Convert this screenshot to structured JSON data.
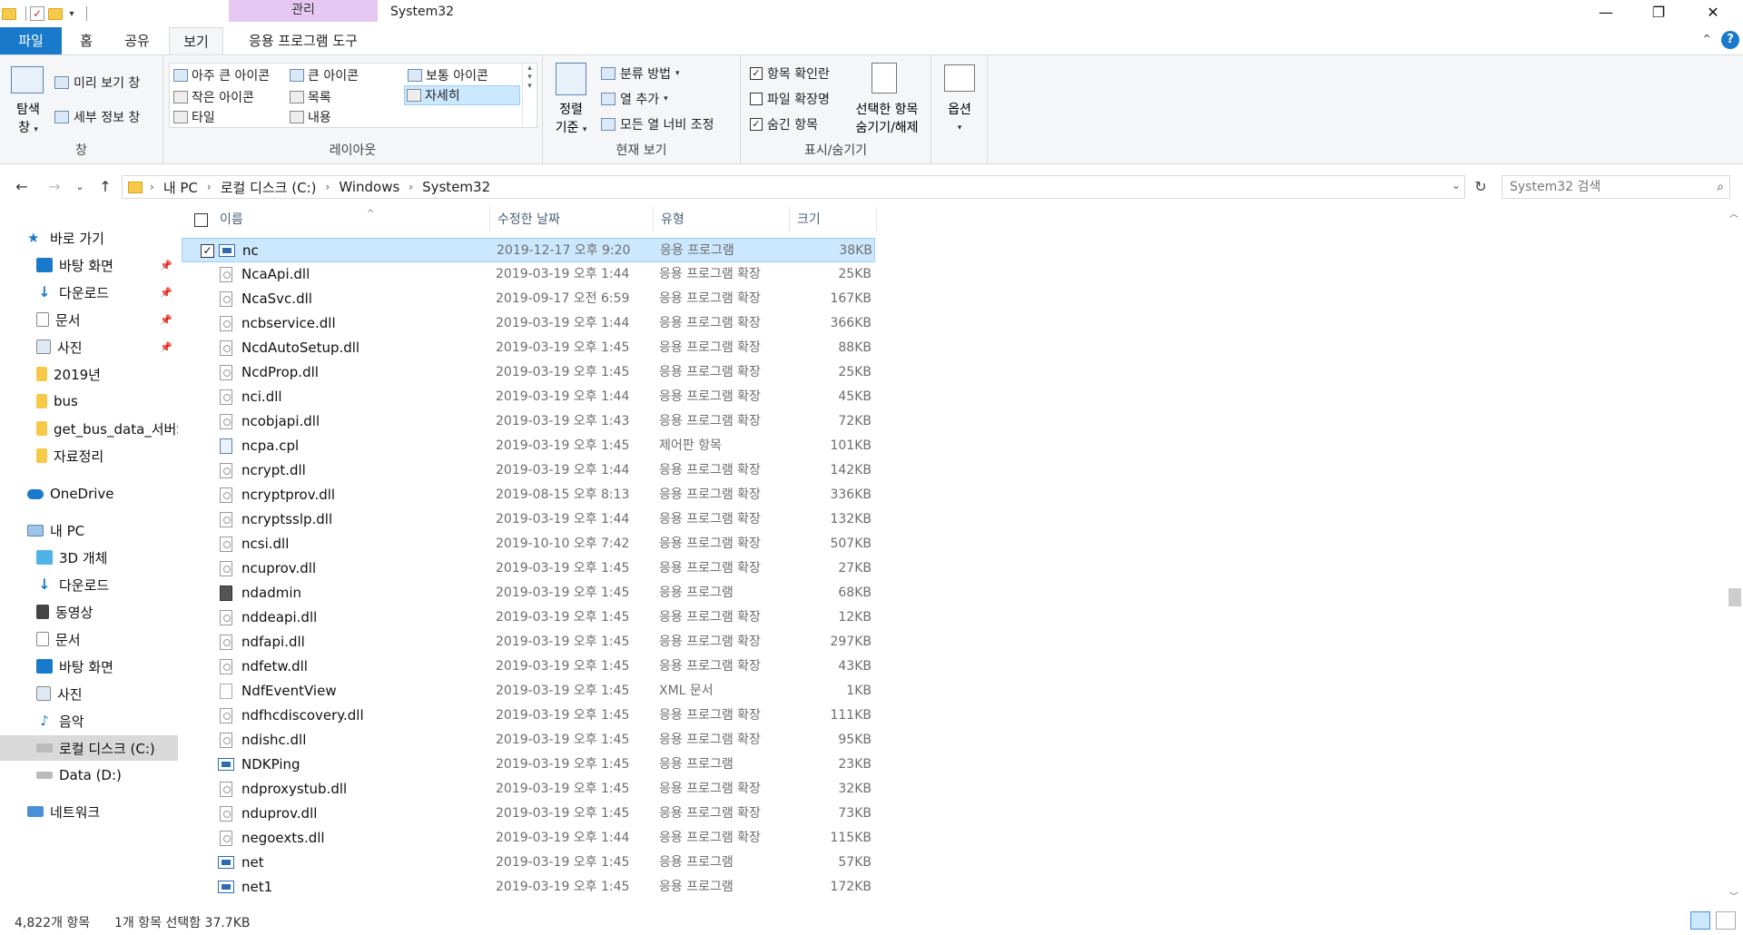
{
  "titlebar": {
    "manage_tab": "관리",
    "title": "System32",
    "minimize": "—",
    "maximize": "❐",
    "close": "✕"
  },
  "tabs": {
    "file": "파일",
    "home": "홈",
    "share": "공유",
    "view": "보기",
    "app_tools": "응용 프로그램 도구"
  },
  "ribbon": {
    "pane_group": {
      "nav_pane": "탐색",
      "nav_pane_2": "창",
      "preview": "미리 보기 창",
      "details": "세부 정보 창",
      "label": "창"
    },
    "layout_group": {
      "extra_large": "아주 큰 아이콘",
      "large": "큰 아이콘",
      "medium": "보통 아이콘",
      "small": "작은 아이콘",
      "list": "목록",
      "details": "자세히",
      "tiles": "타일",
      "content": "내용",
      "label": "레이아웃"
    },
    "current_view_group": {
      "sort_by": "정렬",
      "sort_by_2": "기준",
      "group_by": "분류 방법",
      "add_columns": "열 추가",
      "size_all_columns": "모든 열 너비 조정",
      "label": "현재 보기"
    },
    "show_hide_group": {
      "item_checkboxes": "항목 확인란",
      "file_extensions": "파일 확장명",
      "hidden_items": "숨긴 항목",
      "hide_selected": "선택한 항목",
      "hide_selected_2": "숨기기/해제",
      "label": "표시/숨기기"
    },
    "options": "옵션"
  },
  "address": {
    "crumbs": [
      "내 PC",
      "로컬 디스크 (C:)",
      "Windows",
      "System32"
    ],
    "search_placeholder": "System32 검색"
  },
  "navpane": {
    "quick_access": "바로 가기",
    "qa_items": [
      "바탕 화면",
      "다운로드",
      "문서",
      "사진",
      "2019년",
      "bus",
      "get_bus_data_서버S",
      "자료정리"
    ],
    "onedrive": "OneDrive",
    "this_pc": "내 PC",
    "pc_items": [
      "3D 개체",
      "다운로드",
      "동영상",
      "문서",
      "바탕 화면",
      "사진",
      "음악",
      "로컬 디스크 (C:)",
      "Data (D:)"
    ],
    "network": "네트워크"
  },
  "columns": {
    "name": "이름",
    "modified": "수정한 날짜",
    "type": "유형",
    "size": "크기"
  },
  "files": [
    {
      "name": "nc",
      "date": "2019-12-17 오후 9:20",
      "type": "응용 프로그램",
      "size": "38KB",
      "icon": "exe-icon",
      "selected": true
    },
    {
      "name": "NcaApi.dll",
      "date": "2019-03-19 오후 1:44",
      "type": "응용 프로그램 확장",
      "size": "25KB",
      "icon": "dll-icon"
    },
    {
      "name": "NcaSvc.dll",
      "date": "2019-09-17 오전 6:59",
      "type": "응용 프로그램 확장",
      "size": "167KB",
      "icon": "dll-icon"
    },
    {
      "name": "ncbservice.dll",
      "date": "2019-03-19 오후 1:44",
      "type": "응용 프로그램 확장",
      "size": "366KB",
      "icon": "dll-icon"
    },
    {
      "name": "NcdAutoSetup.dll",
      "date": "2019-03-19 오후 1:45",
      "type": "응용 프로그램 확장",
      "size": "88KB",
      "icon": "dll-icon"
    },
    {
      "name": "NcdProp.dll",
      "date": "2019-03-19 오후 1:45",
      "type": "응용 프로그램 확장",
      "size": "25KB",
      "icon": "dll-icon"
    },
    {
      "name": "nci.dll",
      "date": "2019-03-19 오후 1:44",
      "type": "응용 프로그램 확장",
      "size": "45KB",
      "icon": "dll-icon"
    },
    {
      "name": "ncobjapi.dll",
      "date": "2019-03-19 오후 1:43",
      "type": "응용 프로그램 확장",
      "size": "72KB",
      "icon": "dll-icon"
    },
    {
      "name": "ncpa.cpl",
      "date": "2019-03-19 오후 1:45",
      "type": "제어판 항목",
      "size": "101KB",
      "icon": "cpl-icon"
    },
    {
      "name": "ncrypt.dll",
      "date": "2019-03-19 오후 1:44",
      "type": "응용 프로그램 확장",
      "size": "142KB",
      "icon": "dll-icon"
    },
    {
      "name": "ncryptprov.dll",
      "date": "2019-08-15 오후 8:13",
      "type": "응용 프로그램 확장",
      "size": "336KB",
      "icon": "dll-icon"
    },
    {
      "name": "ncryptsslp.dll",
      "date": "2019-03-19 오후 1:44",
      "type": "응용 프로그램 확장",
      "size": "132KB",
      "icon": "dll-icon"
    },
    {
      "name": "ncsi.dll",
      "date": "2019-10-10 오후 7:42",
      "type": "응용 프로그램 확장",
      "size": "507KB",
      "icon": "dll-icon"
    },
    {
      "name": "ncuprov.dll",
      "date": "2019-03-19 오후 1:45",
      "type": "응용 프로그램 확장",
      "size": "27KB",
      "icon": "dll-icon"
    },
    {
      "name": "ndadmin",
      "date": "2019-03-19 오후 1:45",
      "type": "응용 프로그램",
      "size": "68KB",
      "icon": "admin-icon"
    },
    {
      "name": "nddeapi.dll",
      "date": "2019-03-19 오후 1:45",
      "type": "응용 프로그램 확장",
      "size": "12KB",
      "icon": "dll-icon"
    },
    {
      "name": "ndfapi.dll",
      "date": "2019-03-19 오후 1:45",
      "type": "응용 프로그램 확장",
      "size": "297KB",
      "icon": "dll-icon"
    },
    {
      "name": "ndfetw.dll",
      "date": "2019-03-19 오후 1:45",
      "type": "응용 프로그램 확장",
      "size": "43KB",
      "icon": "dll-icon"
    },
    {
      "name": "NdfEventView",
      "date": "2019-03-19 오후 1:45",
      "type": "XML 문서",
      "size": "1KB",
      "icon": "xml-icon"
    },
    {
      "name": "ndfhcdiscovery.dll",
      "date": "2019-03-19 오후 1:45",
      "type": "응용 프로그램 확장",
      "size": "111KB",
      "icon": "dll-icon"
    },
    {
      "name": "ndishc.dll",
      "date": "2019-03-19 오후 1:45",
      "type": "응용 프로그램 확장",
      "size": "95KB",
      "icon": "dll-icon"
    },
    {
      "name": "NDKPing",
      "date": "2019-03-19 오후 1:45",
      "type": "응용 프로그램",
      "size": "23KB",
      "icon": "exe-icon"
    },
    {
      "name": "ndproxystub.dll",
      "date": "2019-03-19 오후 1:45",
      "type": "응용 프로그램 확장",
      "size": "32KB",
      "icon": "dll-icon"
    },
    {
      "name": "nduprov.dll",
      "date": "2019-03-19 오후 1:45",
      "type": "응용 프로그램 확장",
      "size": "73KB",
      "icon": "dll-icon"
    },
    {
      "name": "negoexts.dll",
      "date": "2019-03-19 오후 1:44",
      "type": "응용 프로그램 확장",
      "size": "115KB",
      "icon": "dll-icon"
    },
    {
      "name": "net",
      "date": "2019-03-19 오후 1:45",
      "type": "응용 프로그램",
      "size": "57KB",
      "icon": "exe-icon"
    },
    {
      "name": "net1",
      "date": "2019-03-19 오후 1:45",
      "type": "응용 프로그램",
      "size": "172KB",
      "icon": "exe-icon"
    }
  ],
  "status": {
    "item_count": "4,822개 항목",
    "selected": "1개 항목 선택함 37.7KB"
  }
}
